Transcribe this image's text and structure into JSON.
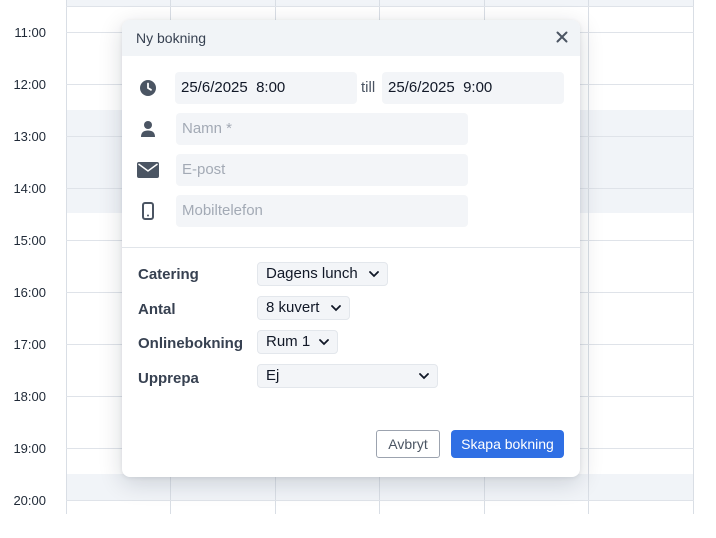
{
  "calendar": {
    "times": [
      "11:00",
      "12:00",
      "13:00",
      "14:00",
      "15:00",
      "16:00",
      "17:00",
      "18:00",
      "19:00",
      "20:00"
    ]
  },
  "dialog": {
    "title": "Ny bokning",
    "close_icon": "close-icon",
    "start_datetime": "25/6/2025  8:00",
    "till_label": "till",
    "end_datetime": "25/6/2025  9:00",
    "name_placeholder": "Namn *",
    "email_placeholder": "E-post",
    "phone_placeholder": "Mobiltelefon",
    "icons": {
      "time": "clock-icon",
      "name": "person-icon",
      "email": "envelope-icon",
      "phone": "mobile-phone-icon"
    },
    "options": {
      "catering": {
        "label": "Catering",
        "value": "Dagens lunch"
      },
      "antal": {
        "label": "Antal",
        "value": "8 kuvert"
      },
      "online": {
        "label": "Onlinebokning",
        "value": "Rum 1"
      },
      "upprepa": {
        "label": "Upprepa",
        "value": "Ej"
      }
    },
    "cancel_label": "Avbryt",
    "submit_label": "Skapa bokning",
    "colors": {
      "primary": "#2f6fe4",
      "header_bg": "#f1f4f7",
      "field_bg": "#f3f5f8"
    }
  }
}
